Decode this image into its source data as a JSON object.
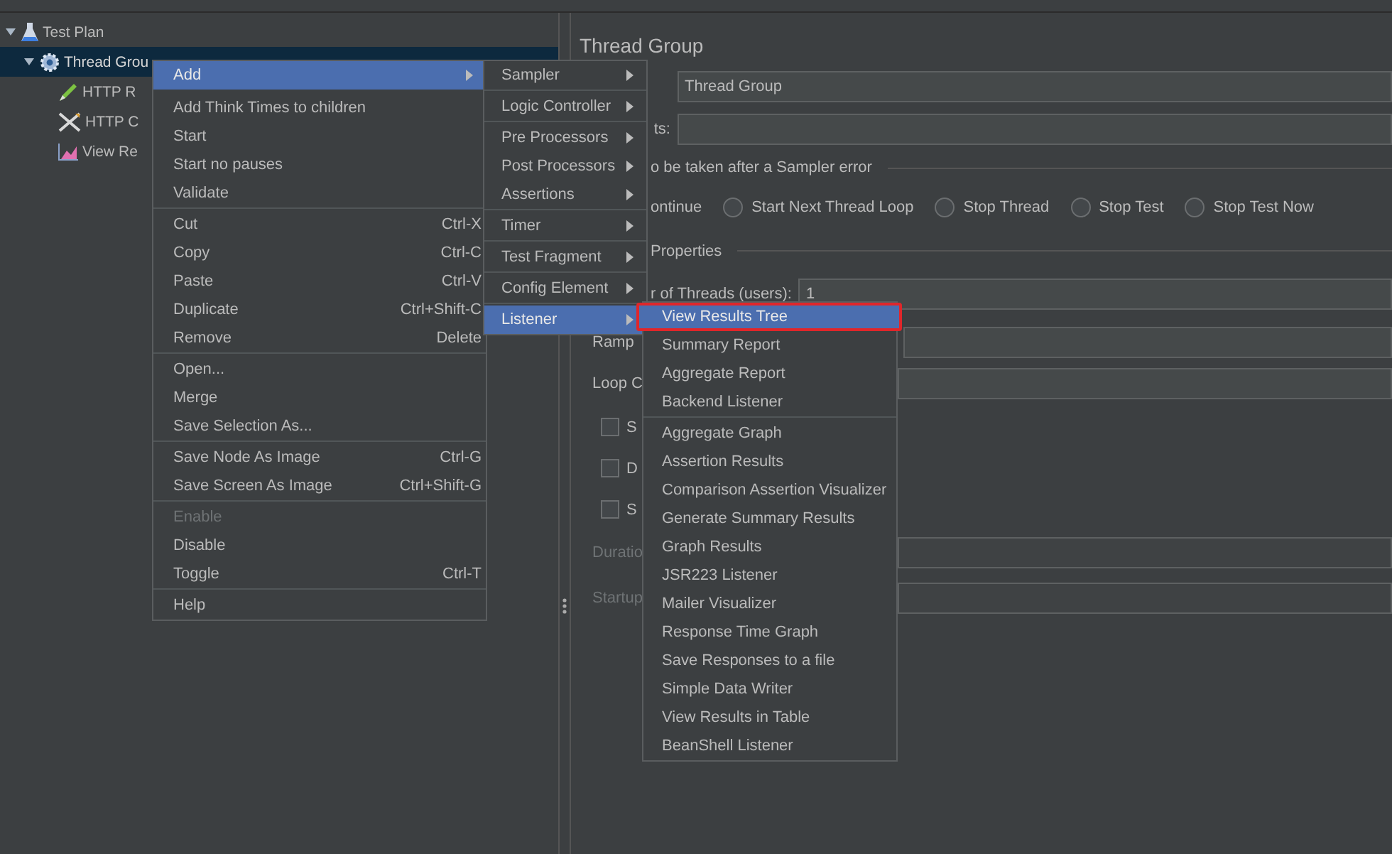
{
  "tree": [
    {
      "label": "Test Plan",
      "kind": "plan",
      "expanded": true,
      "selected": false,
      "children": [
        {
          "label": "Thread Grou",
          "kind": "thread_group",
          "expanded": true,
          "selected": true,
          "children": [
            {
              "label": "HTTP R",
              "kind": "sampler",
              "selected": false
            },
            {
              "label": "HTTP C",
              "kind": "config",
              "selected": false
            },
            {
              "label": "View Re",
              "kind": "listener",
              "selected": false
            }
          ]
        }
      ]
    }
  ],
  "form": {
    "title": "Thread Group",
    "name_field": {
      "value": "Thread Group"
    },
    "comments_label": "ts:",
    "error_action": {
      "label": "o be taken after a Sampler error",
      "continue_label": "ontinue",
      "options": [
        {
          "label": "Start Next Thread Loop",
          "selected": false
        },
        {
          "label": "Stop Thread",
          "selected": false
        },
        {
          "label": "Stop Test",
          "selected": false
        },
        {
          "label": "Stop Test Now",
          "selected": false
        }
      ]
    },
    "properties_label": "Properties",
    "threads": {
      "label": "r of Threads (users):",
      "value": "1"
    },
    "ramp_label": "Ramp",
    "loop_label": "Loop C",
    "checkboxes": [
      {
        "label": "S",
        "checked": false
      },
      {
        "label": "D",
        "checked": false
      },
      {
        "label": "S",
        "checked": false
      }
    ],
    "duration": {
      "label": "Duratio",
      "disabled": true
    },
    "startup": {
      "label": "Startup",
      "disabled": true
    }
  },
  "context_menu": {
    "items": [
      {
        "kind": "item",
        "label": "Add",
        "submenu": true,
        "selected": true,
        "disabled": false
      },
      {
        "kind": "item",
        "label": "Add Think Times to children",
        "selected": false,
        "disabled": false
      },
      {
        "kind": "item",
        "label": "Start",
        "selected": false,
        "disabled": false
      },
      {
        "kind": "item",
        "label": "Start no pauses",
        "selected": false,
        "disabled": false
      },
      {
        "kind": "item",
        "label": "Validate",
        "selected": false,
        "disabled": false
      },
      {
        "kind": "separator"
      },
      {
        "kind": "item",
        "label": "Cut",
        "shortcut": "Ctrl-X",
        "selected": false,
        "disabled": false
      },
      {
        "kind": "item",
        "label": "Copy",
        "shortcut": "Ctrl-C",
        "selected": false,
        "disabled": false
      },
      {
        "kind": "item",
        "label": "Paste",
        "shortcut": "Ctrl-V",
        "selected": false,
        "disabled": false
      },
      {
        "kind": "item",
        "label": "Duplicate",
        "shortcut": "Ctrl+Shift-C",
        "selected": false,
        "disabled": false
      },
      {
        "kind": "item",
        "label": "Remove",
        "shortcut": "Delete",
        "selected": false,
        "disabled": false
      },
      {
        "kind": "separator"
      },
      {
        "kind": "item",
        "label": "Open...",
        "selected": false,
        "disabled": false
      },
      {
        "kind": "item",
        "label": "Merge",
        "selected": false,
        "disabled": false
      },
      {
        "kind": "item",
        "label": "Save Selection As...",
        "selected": false,
        "disabled": false
      },
      {
        "kind": "separator"
      },
      {
        "kind": "item",
        "label": "Save Node As Image",
        "shortcut": "Ctrl-G",
        "selected": false,
        "disabled": false
      },
      {
        "kind": "item",
        "label": "Save Screen As Image",
        "shortcut": "Ctrl+Shift-G",
        "selected": false,
        "disabled": false
      },
      {
        "kind": "separator"
      },
      {
        "kind": "item",
        "label": "Enable",
        "selected": false,
        "disabled": true
      },
      {
        "kind": "item",
        "label": "Disable",
        "selected": false,
        "disabled": false
      },
      {
        "kind": "item",
        "label": "Toggle",
        "shortcut": "Ctrl-T",
        "selected": false,
        "disabled": false
      },
      {
        "kind": "separator"
      },
      {
        "kind": "item",
        "label": "Help",
        "selected": false,
        "disabled": false
      }
    ]
  },
  "add_menu": {
    "items": [
      {
        "kind": "item",
        "label": "Sampler",
        "submenu": true,
        "selected": false
      },
      {
        "kind": "separator"
      },
      {
        "kind": "item",
        "label": "Logic Controller",
        "submenu": true,
        "selected": false
      },
      {
        "kind": "separator"
      },
      {
        "kind": "item",
        "label": "Pre Processors",
        "submenu": true,
        "selected": false
      },
      {
        "kind": "item",
        "label": "Post Processors",
        "submenu": true,
        "selected": false
      },
      {
        "kind": "item",
        "label": "Assertions",
        "submenu": true,
        "selected": false
      },
      {
        "kind": "separator"
      },
      {
        "kind": "item",
        "label": "Timer",
        "submenu": true,
        "selected": false
      },
      {
        "kind": "separator"
      },
      {
        "kind": "item",
        "label": "Test Fragment",
        "submenu": true,
        "selected": false
      },
      {
        "kind": "separator"
      },
      {
        "kind": "item",
        "label": "Config Element",
        "submenu": true,
        "selected": false
      },
      {
        "kind": "separator"
      },
      {
        "kind": "item",
        "label": "Listener",
        "submenu": true,
        "selected": true
      }
    ]
  },
  "listener_menu": {
    "items": [
      {
        "kind": "item",
        "label": "View Results Tree",
        "selected": true,
        "outlined": true
      },
      {
        "kind": "item",
        "label": "Summary Report",
        "selected": false,
        "outlined": false
      },
      {
        "kind": "item",
        "label": "Aggregate Report",
        "selected": false,
        "outlined": false
      },
      {
        "kind": "item",
        "label": "Backend Listener",
        "selected": false,
        "outlined": false
      },
      {
        "kind": "separator"
      },
      {
        "kind": "item",
        "label": "Aggregate Graph",
        "selected": false,
        "outlined": false
      },
      {
        "kind": "item",
        "label": "Assertion Results",
        "selected": false,
        "outlined": false
      },
      {
        "kind": "item",
        "label": "Comparison Assertion Visualizer",
        "selected": false,
        "outlined": false
      },
      {
        "kind": "item",
        "label": "Generate Summary Results",
        "selected": false,
        "outlined": false
      },
      {
        "kind": "item",
        "label": "Graph Results",
        "selected": false,
        "outlined": false
      },
      {
        "kind": "item",
        "label": "JSR223 Listener",
        "selected": false,
        "outlined": false
      },
      {
        "kind": "item",
        "label": "Mailer Visualizer",
        "selected": false,
        "outlined": false
      },
      {
        "kind": "item",
        "label": "Response Time Graph",
        "selected": false,
        "outlined": false
      },
      {
        "kind": "item",
        "label": "Save Responses to a file",
        "selected": false,
        "outlined": false
      },
      {
        "kind": "item",
        "label": "Simple Data Writer",
        "selected": false,
        "outlined": false
      },
      {
        "kind": "item",
        "label": "View Results in Table",
        "selected": false,
        "outlined": false
      },
      {
        "kind": "item",
        "label": "BeanShell Listener",
        "selected": false,
        "outlined": false
      }
    ]
  }
}
